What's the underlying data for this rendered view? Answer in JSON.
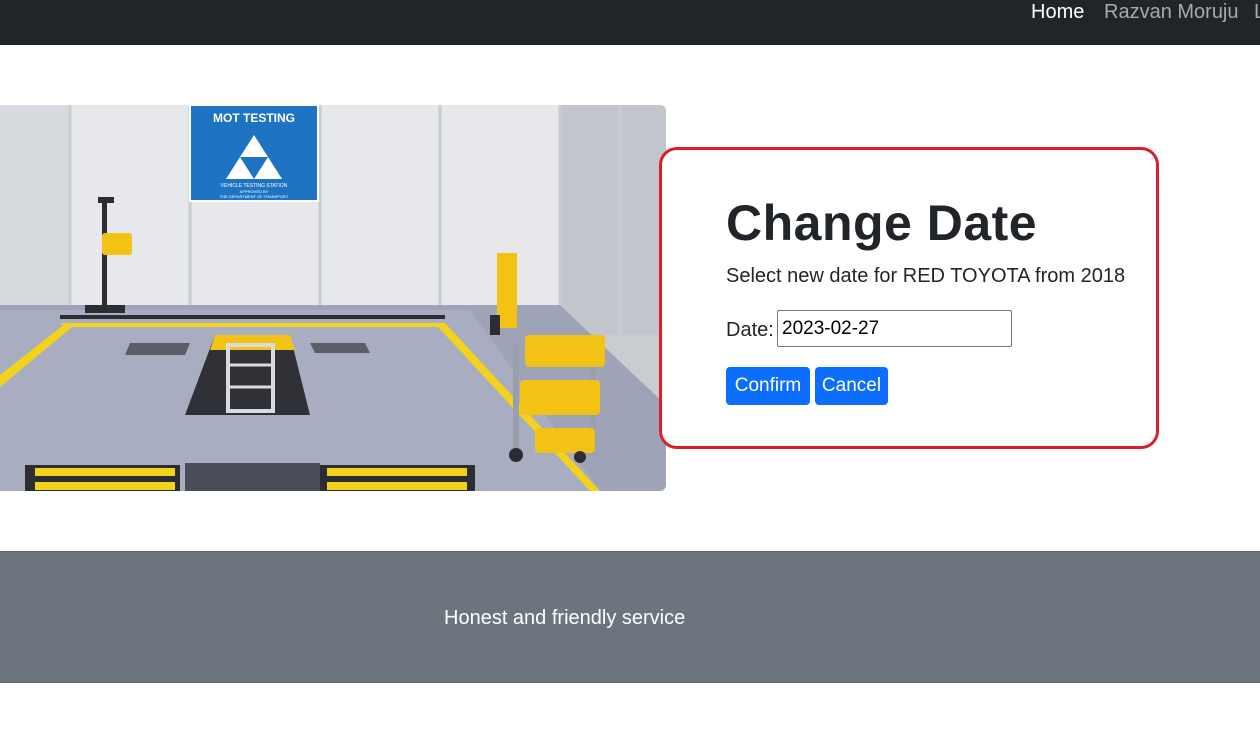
{
  "navbar": {
    "items": [
      {
        "label": "Home",
        "active": true
      },
      {
        "label": "Razvan Moruju",
        "active": false
      },
      {
        "label": "L",
        "active": false
      }
    ]
  },
  "hero": {
    "sign_title": "MOT TESTING",
    "sign_line1": "VEHICLE TESTING STATION",
    "sign_line2": "APPROVED BY",
    "sign_line3": "THE DEPARTMENT OF TRANSPORT"
  },
  "form": {
    "title": "Change Date",
    "subtitle": "Select new date for RED TOYOTA from 2018",
    "date_label": "Date:",
    "date_value": "2023-02-27",
    "confirm_label": "Confirm",
    "cancel_label": "Cancel"
  },
  "footer": {
    "text": "Honest and friendly service"
  },
  "colors": {
    "navbar_bg": "#212529",
    "highlight_border": "#dc1f26",
    "primary_button": "#0d6efd",
    "footer_bg": "#6c757d"
  }
}
